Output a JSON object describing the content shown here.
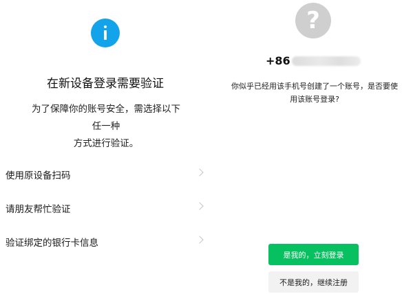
{
  "verification": {
    "icon": "info-icon",
    "accent_color": "#12a3ea",
    "title": "在新设备登录需要验证",
    "description_line1": "为了保障你的账号安全，需选择以下任一种",
    "description_line2": "方式进行验证。",
    "options": [
      {
        "label": "使用原设备扫码",
        "icon": "chevron-right-icon"
      },
      {
        "label": "请朋友帮忙验证",
        "icon": "chevron-right-icon"
      },
      {
        "label": "验证绑定的银行卡信息",
        "icon": "chevron-right-icon"
      }
    ]
  },
  "account_check": {
    "avatar_symbol": "?",
    "avatar_icon": "unknown-user-avatar",
    "phone_prefix": "+86",
    "question_line1": "你似乎已经用该手机号创建了一个账号，是否要使",
    "question_line2": "用该账号登录?",
    "confirm_label": "是我的，立刻登录",
    "confirm_color": "#07c160",
    "register_label": "不是我的，继续注册"
  }
}
